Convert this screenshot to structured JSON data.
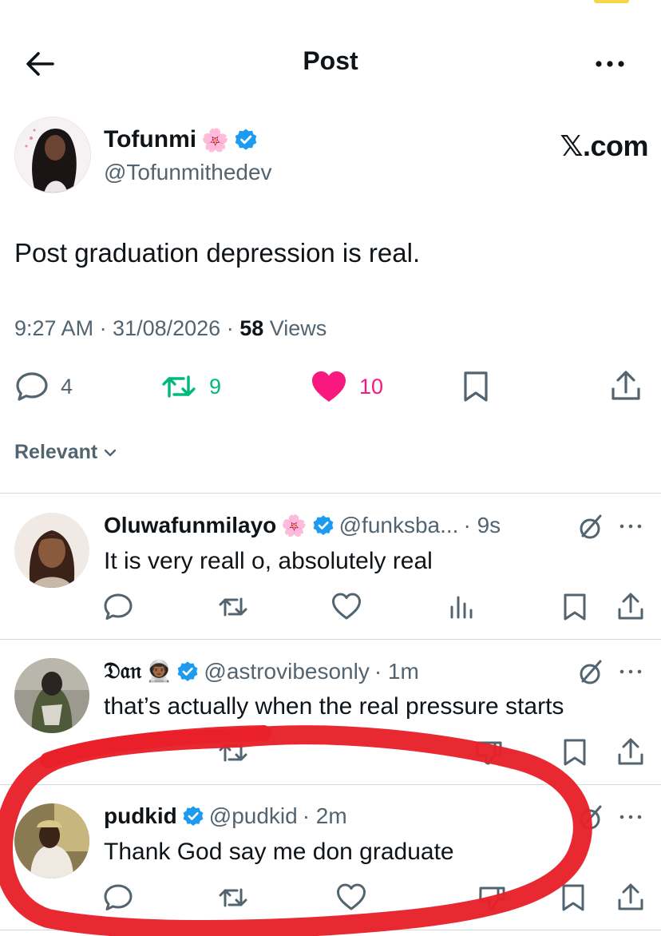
{
  "header": {
    "title": "Post",
    "back_icon": "arrow-left-icon",
    "more_icon": "more-horizontal-icon"
  },
  "post": {
    "author": {
      "name": "Tofunmi",
      "name_emoji": "🌸",
      "handle": "@Tofunmithedev",
      "verified": true
    },
    "watermark": "𝕏.com",
    "text": "Post graduation depression is real.",
    "timestamp": "9:27 AM · 31/08/2026 · ",
    "views_count": "58",
    "views_label": " Views",
    "stats": {
      "replies": "4",
      "reposts": "9",
      "likes": "10"
    }
  },
  "sort": {
    "label": "Relevant"
  },
  "replies": [
    {
      "name": "Oluwafunmilayo",
      "emoji": "🌸",
      "verified": true,
      "handle": "@funksba...",
      "time": "· 9s",
      "text": "It is very reall o, absolutely real"
    },
    {
      "name": "𝔇𝔞𝔫",
      "emoji": "👨🏾‍🚀",
      "verified": true,
      "handle": "@astrovibesonly",
      "time": "· 1m",
      "text": "that’s actually when the real pressure starts"
    },
    {
      "name": "pudkid",
      "emoji": "",
      "verified": true,
      "handle": "@pudkid",
      "time": "· 2m",
      "text": "Thank God say me don graduate"
    }
  ],
  "colors": {
    "accent_blue": "#1d9bf0",
    "repost_green": "#00ba7c",
    "like_pink": "#f91880",
    "muted": "#536471",
    "text": "#0f1419",
    "annotation_red": "#e8202a"
  }
}
